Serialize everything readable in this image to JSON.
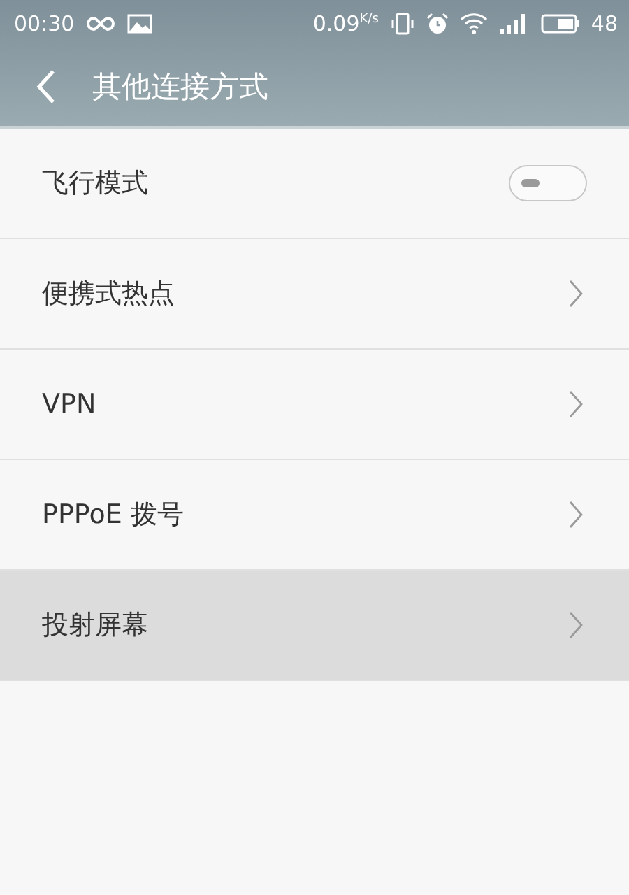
{
  "status_bar": {
    "time": "00:30",
    "speed": "0.09",
    "speed_unit": "K/s",
    "battery": "48"
  },
  "header": {
    "title": "其他连接方式"
  },
  "items": [
    {
      "label": "飞行模式",
      "kind": "toggle",
      "on": false,
      "selected": false
    },
    {
      "label": "便携式热点",
      "kind": "link",
      "selected": false
    },
    {
      "label": "VPN",
      "kind": "link",
      "selected": false
    },
    {
      "label": "PPPoE 拨号",
      "kind": "link",
      "selected": false
    },
    {
      "label": "投射屏幕",
      "kind": "link",
      "selected": true
    }
  ]
}
